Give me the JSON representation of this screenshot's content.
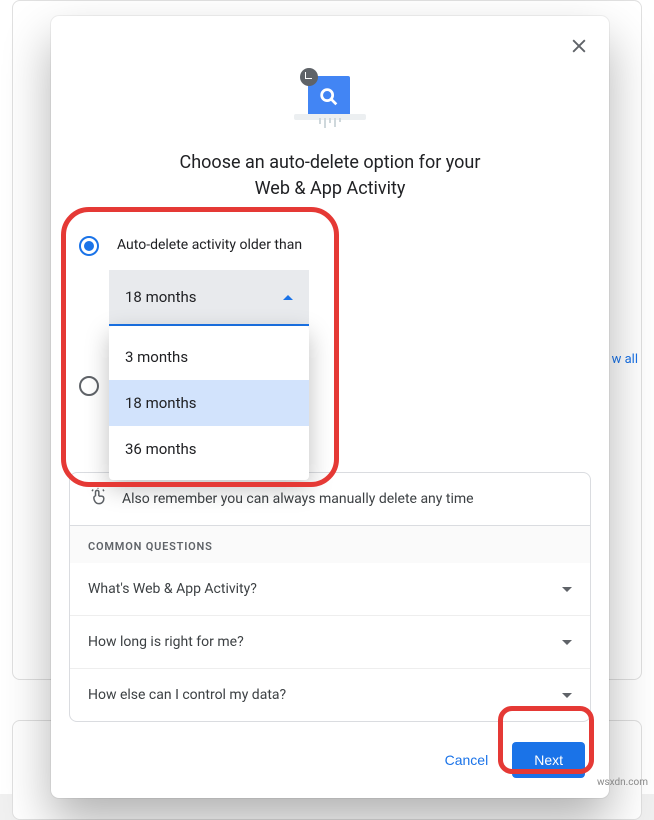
{
  "modal": {
    "title_line1": "Choose an auto-delete option for your",
    "title_line2": "Web & App Activity",
    "option1_label": "Auto-delete activity older than",
    "select_value": "18 months",
    "dropdown_options": [
      "3 months",
      "18 months",
      "36 months"
    ],
    "info_text": "Also remember you can always manually delete any time",
    "cq_header": "COMMON QUESTIONS",
    "cq_items": [
      "What's Web & App Activity?",
      "How long is right for me?",
      "How else can I control my data?"
    ],
    "cancel_label": "Cancel",
    "next_label": "Next"
  },
  "bg": {
    "view_all": "w all"
  },
  "watermark": "wsxdn.com"
}
